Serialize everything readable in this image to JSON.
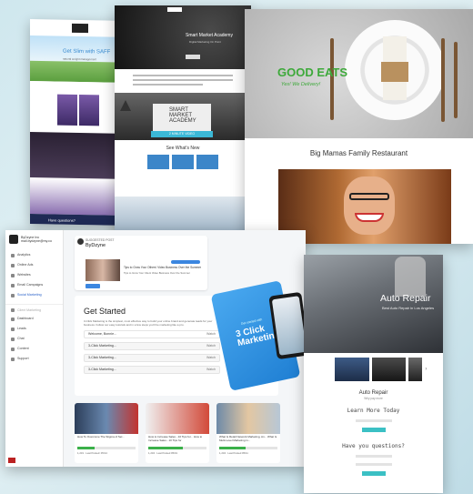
{
  "saff": {
    "headline": "Get Slim with SAFF",
    "subline": "natural weight management",
    "contact_label": "Have questions?"
  },
  "sma": {
    "hero_title": "Smart Market Academy",
    "hero_sub": "Digital Marketing On Point",
    "video_logo": "SMART MARKET ACADEMY",
    "video_cta": "2 MINUTE VIDEO",
    "section_title": "See What's New"
  },
  "eats": {
    "title": "GOOD EATS",
    "tagline": "Yes! We Delivery!",
    "restaurant_name": "Big Mamas Family Restaurant"
  },
  "dashboard": {
    "brand_name": "ByDzyne Inc",
    "brand_email": "mail.bydzyne@my.co",
    "nav": [
      {
        "label": "Analytics",
        "active": false
      },
      {
        "label": "Online Ads",
        "active": false
      },
      {
        "label": "Websites",
        "active": false
      },
      {
        "label": "Email Campaigns",
        "active": false
      },
      {
        "label": "Social Marketing",
        "active": true
      },
      {
        "label": "Client Marketing",
        "active": false
      },
      {
        "label": "Dashboard",
        "active": false
      },
      {
        "label": "Leads",
        "active": false
      },
      {
        "label": "Chat",
        "active": false
      },
      {
        "label": "Content",
        "active": false
      },
      {
        "label": "Support",
        "active": false
      }
    ],
    "featured_label": "SUGGESTED POST",
    "featured_author": "ByDzyne",
    "featured_line1": "Tips to Grow Your Others' Video Business Over the Summer",
    "featured_line2": "Tips to Grow Your Client Video Business Over the Summer",
    "get_started_title": "Get Started",
    "get_started_desc": "3-Click Marketing is the simplest, most effective way to build your online brand and generate leads for your business. Follow our easy tutorials and in a few steps you'll be marketing like a pro.",
    "rows": [
      {
        "label": "Welcome, Bonnie...",
        "action": "Watch"
      },
      {
        "label": "3-Click Marketing...",
        "action": "Watch"
      },
      {
        "label": "3-Click Marketing...",
        "action": "Watch"
      },
      {
        "label": "3-Click Marketing...",
        "action": "Watch"
      }
    ],
    "promo_small": "Get started with",
    "promo_big": "3 Click Marketing",
    "cards": [
      {
        "caption": "How To Overcome The Stigma of Sel...",
        "progress": 0.3,
        "meta": "1,231 · Last Posted: 05/14"
      },
      {
        "caption": "How to Increase Sales - 10 Tips for... How to Increase Sales - 10 Tips for",
        "progress": 0.6,
        "meta": "1,234 · Last Posted 05/01"
      },
      {
        "caption": "What Is Retail Network Marketing, An... What Is Multi-Level Marketing in...",
        "progress": 0.45,
        "meta": "1,234 · Last Posted 05/11"
      }
    ]
  },
  "auto": {
    "hero_title": "Auto Repair",
    "hero_sub": "Best Auto Repair in Los Angeles",
    "name": "Auto Repair",
    "desc": "Why pay more",
    "learn_more": "Learn More Today",
    "questions": "Have you questions?"
  }
}
